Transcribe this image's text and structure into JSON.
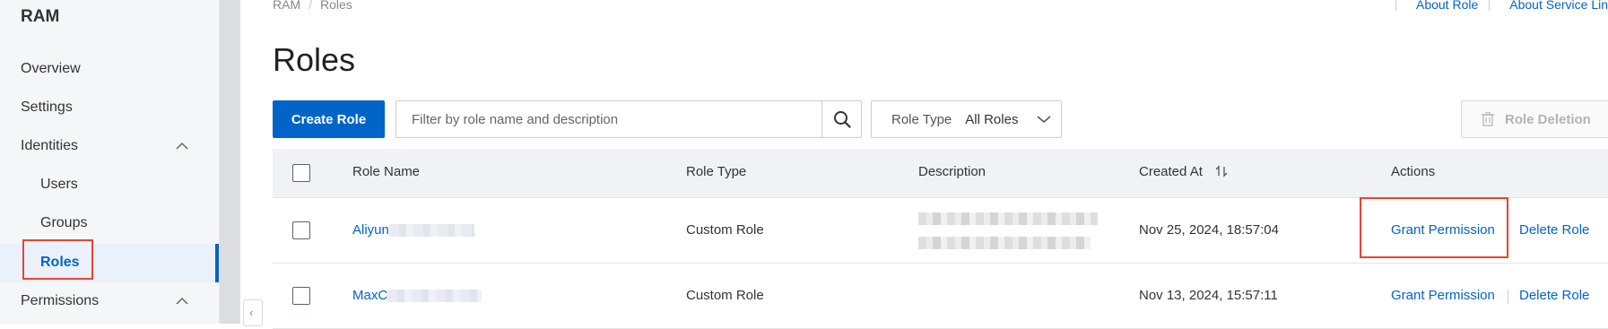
{
  "sidebar": {
    "brand": "RAM",
    "items": [
      {
        "label": "Overview"
      },
      {
        "label": "Settings"
      },
      {
        "label": "Identities"
      },
      {
        "label": "Users"
      },
      {
        "label": "Groups"
      },
      {
        "label": "Roles"
      },
      {
        "label": "Permissions"
      }
    ],
    "active": "Roles"
  },
  "breadcrumb": [
    "RAM",
    "Roles"
  ],
  "top_links": [
    "About Role",
    "About Service Lin"
  ],
  "page_title": "Roles",
  "toolbar": {
    "create_label": "Create Role",
    "search_placeholder": "Filter by role name and description",
    "role_type_label": "Role Type",
    "role_type_value": "All Roles",
    "delete_label": "Role Deletion"
  },
  "table": {
    "headers": [
      "Role Name",
      "Role Type",
      "Description",
      "Created At",
      "Actions"
    ],
    "rows": [
      {
        "name": "Aliyun",
        "type": "Custom Role",
        "created": "Nov 25, 2024, 18:57:04",
        "grant": "Grant Permission",
        "delete": "Delete Role"
      },
      {
        "name": "MaxC",
        "type": "Custom Role",
        "created": "Nov 13, 2024, 15:57:11",
        "grant": "Grant Permission",
        "delete": "Delete Role"
      }
    ]
  },
  "colors": {
    "accent": "#0064c8",
    "highlight": "#e8452f"
  },
  "icons": [
    "chevron-up-icon",
    "search-icon",
    "chevron-down-icon",
    "trash-icon",
    "sort-icon",
    "chevron-left-icon"
  ]
}
